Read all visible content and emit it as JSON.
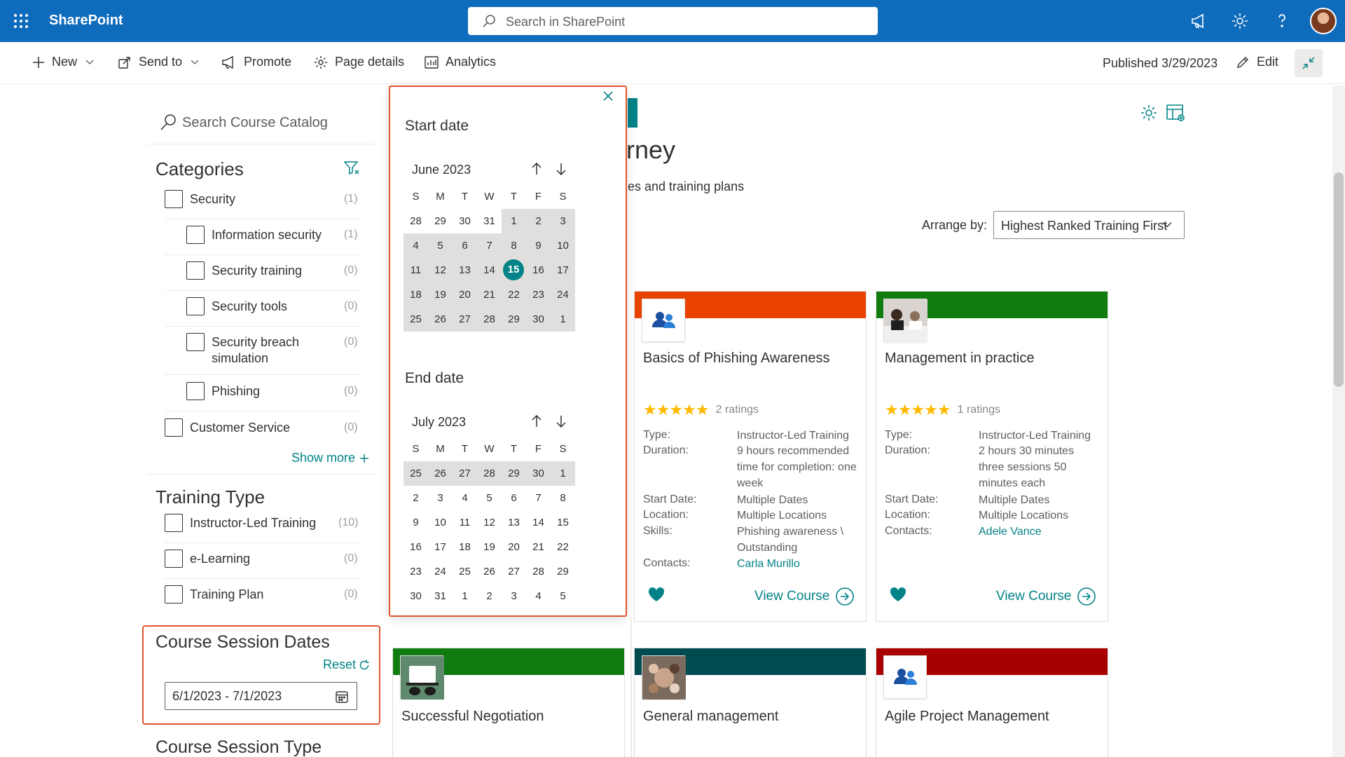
{
  "app": {
    "name": "SharePoint",
    "search_placeholder": "Search in SharePoint"
  },
  "commands": {
    "new": "New",
    "send_to": "Send to",
    "promote": "Promote",
    "page_details": "Page details",
    "analytics": "Analytics",
    "published": "Published 3/29/2023",
    "edit": "Edit"
  },
  "filters": {
    "search_placeholder": "Search Course Catalog",
    "categories_title": "Categories",
    "categories": [
      {
        "label": "Security",
        "count": "(1)"
      },
      {
        "label": "Information security",
        "count": "(1)"
      },
      {
        "label": "Security training",
        "count": "(0)"
      },
      {
        "label": "Security tools",
        "count": "(0)"
      },
      {
        "label": "Security breach simulation",
        "count": "(0)"
      },
      {
        "label": "Phishing",
        "count": "(0)"
      },
      {
        "label": "Customer Service",
        "count": "(0)"
      }
    ],
    "show_more": "Show more",
    "training_type_title": "Training Type",
    "training_types": [
      {
        "label": "Instructor-Led Training",
        "count": "(10)"
      },
      {
        "label": "e-Learning",
        "count": "(0)"
      },
      {
        "label": "Training Plan",
        "count": "(0)"
      }
    ],
    "session_dates_title": "Course Session Dates",
    "reset": "Reset",
    "date_range": "6/1/2023 - 7/1/2023",
    "session_type_title": "Course Session Type"
  },
  "calendar": {
    "start_label": "Start date",
    "start_month": "June 2023",
    "end_label": "End date",
    "end_month": "July 2023",
    "weekdays": [
      "S",
      "M",
      "T",
      "W",
      "T",
      "F",
      "S"
    ],
    "start_days": [
      "28",
      "29",
      "30",
      "31",
      "1",
      "2",
      "3",
      "4",
      "5",
      "6",
      "7",
      "8",
      "9",
      "10",
      "11",
      "12",
      "13",
      "14",
      "15",
      "16",
      "17",
      "18",
      "19",
      "20",
      "21",
      "22",
      "23",
      "24",
      "25",
      "26",
      "27",
      "28",
      "29",
      "30",
      "1"
    ],
    "end_days": [
      "25",
      "26",
      "27",
      "28",
      "29",
      "30",
      "1",
      "2",
      "3",
      "4",
      "5",
      "6",
      "7",
      "8",
      "9",
      "10",
      "11",
      "12",
      "13",
      "14",
      "15",
      "16",
      "17",
      "18",
      "19",
      "20",
      "21",
      "22",
      "23",
      "24",
      "25",
      "26",
      "27",
      "28",
      "29",
      "30",
      "31",
      "1",
      "2",
      "3",
      "4",
      "5"
    ],
    "selected_day": "15"
  },
  "main": {
    "title_fragment": "rney",
    "subtitle_fragment": "es and training plans",
    "arrange_label": "Arrange by:",
    "arrange_value": "Highest Ranked Training First"
  },
  "cards": [
    {
      "title": "Basics of Phishing Awareness",
      "band_color": "#ea4300",
      "stars": "★★★★★",
      "ratings": "2 ratings",
      "type_label": "Type:",
      "type": "Instructor-Led Training",
      "duration_label": "Duration:",
      "duration": "9 hours recommended time for completion: one week",
      "start_label": "Start Date:",
      "start": "Multiple Dates",
      "location_label": "Location:",
      "location": "Multiple Locations",
      "skills_label": "Skills:",
      "skills": "Phishing awareness \\ Outstanding",
      "contacts_label": "Contacts:",
      "contact": "Carla Murillo",
      "view": "View Course"
    },
    {
      "title": "Management in practice",
      "band_color": "#107c10",
      "stars": "★★★★★",
      "ratings": "1 ratings",
      "type_label": "Type:",
      "type": "Instructor-Led Training",
      "duration_label": "Duration:",
      "duration": "2 hours 30 minutes three sessions 50 minutes each",
      "start_label": "Start Date:",
      "start": "Multiple Dates",
      "location_label": "Location:",
      "location": "Multiple Locations",
      "contacts_label": "Contacts:",
      "contact": "Adele Vance",
      "view": "View Course"
    },
    {
      "title": "Successful Negotiation",
      "band_color": "#107c10"
    },
    {
      "title": "General management",
      "band_color": "#004b50"
    },
    {
      "title": "Agile Project Management",
      "band_color": "#a80000"
    }
  ],
  "colors": {
    "suite": "#0f6cbd",
    "accent": "#038387",
    "highlight": "#e0562e"
  }
}
